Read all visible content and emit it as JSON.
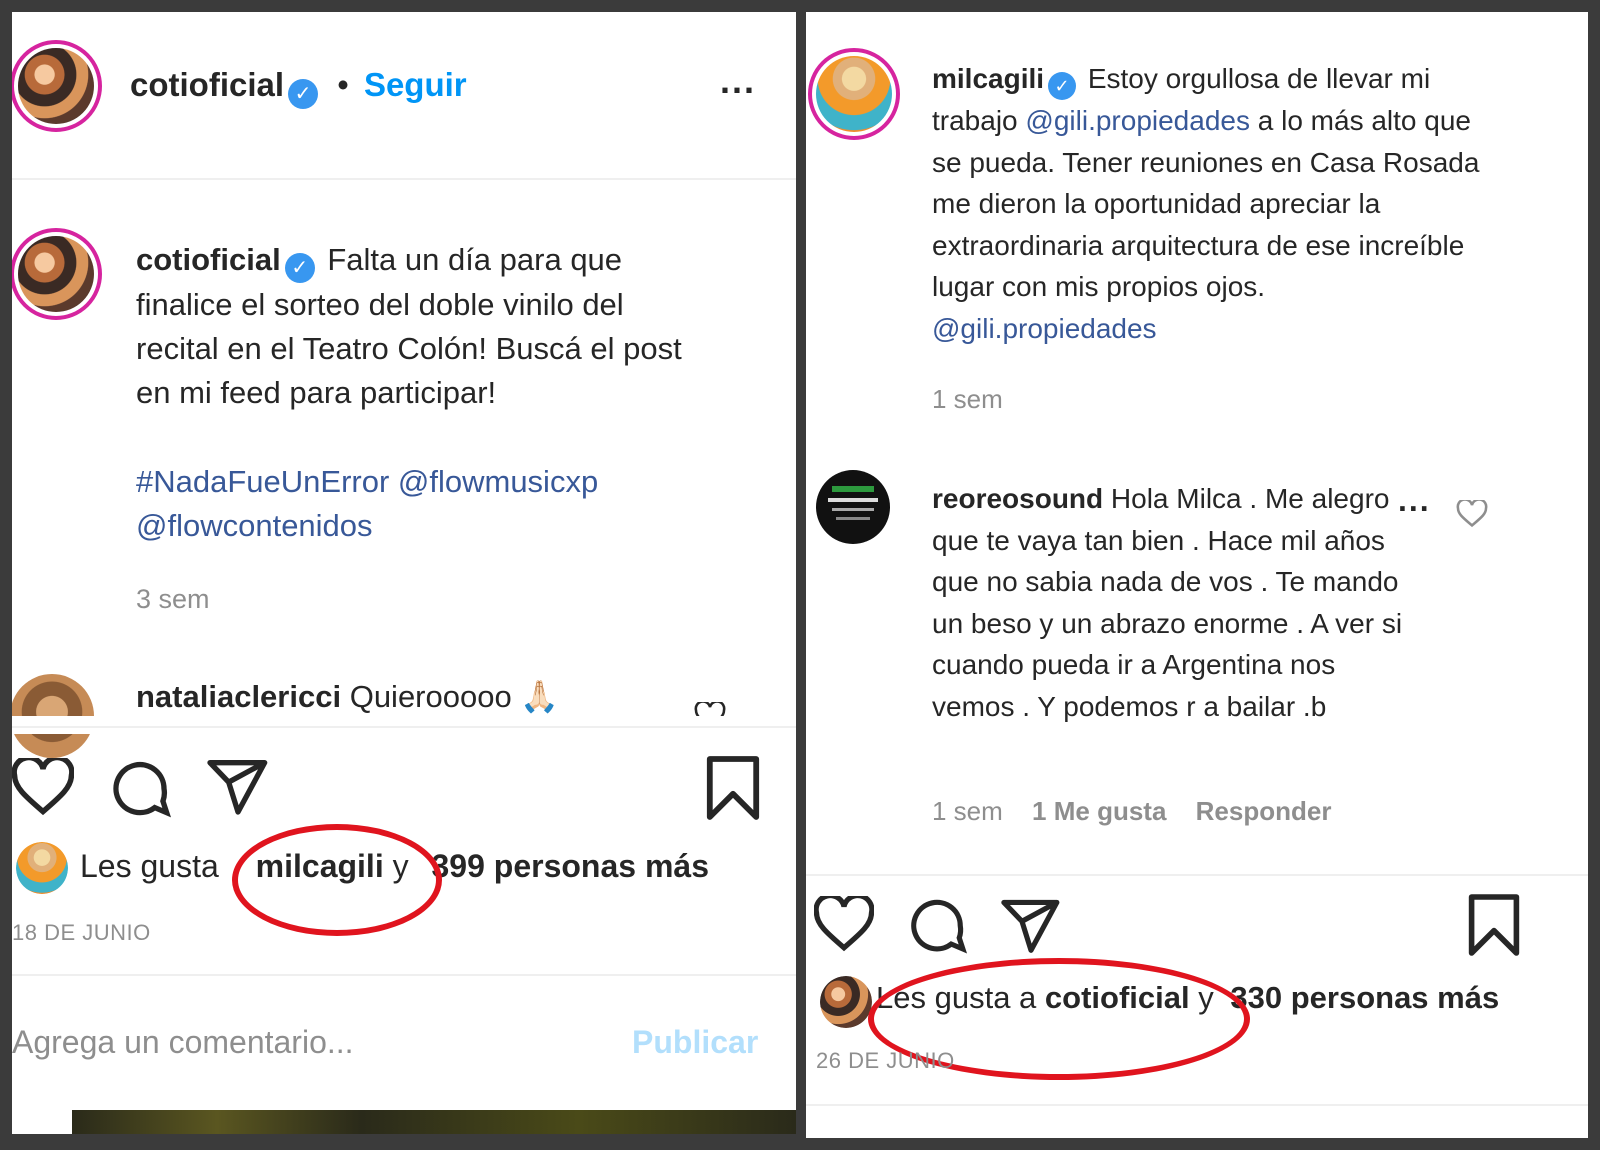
{
  "left_post": {
    "header": {
      "username": "cotioficial",
      "separator": "•",
      "follow_label": "Seguir",
      "more_label": "..."
    },
    "caption": {
      "username": "cotioficial",
      "text": "Falta un día para que finalice el sorteo del doble vinilo del recital en el Teatro Colón! Buscá el post en mi feed para participar!",
      "tags_line1": "#NadaFueUnError @flowmusicxp",
      "tags_line2": "@flowcontenidos",
      "time": "3 sem"
    },
    "comment": {
      "username": "nataliaclericci",
      "text": "Quierooooo",
      "emoji": "🙏🏻"
    },
    "likes": {
      "prefix": "Les gusta",
      "liker": "milcagili",
      "conjunction": "y",
      "rest": "399 personas más"
    },
    "date": "18 DE JUNIO",
    "comment_box": {
      "placeholder": "Agrega un comentario...",
      "publish_label": "Publicar"
    }
  },
  "right_post": {
    "caption": {
      "username": "milcagili",
      "text_before": "Estoy orgullosa de llevar mi trabajo",
      "mention1": "@gili.propiedades",
      "text_after": "a lo más alto que se pueda. Tener reuniones en Casa Rosada me dieron la oportunidad apreciar la extraordinaria arquitectura de ese increíble lugar con mis propios ojos.",
      "mention2": "@gili.propiedades",
      "time": "1 sem"
    },
    "comment": {
      "username": "reoreosound",
      "text": "Hola Milca . Me alegro que te vaya tan bien . Hace mil años que no sabia nada de vos . Te mando un beso y un abrazo enorme . A ver si cuando pueda ir a Argentina nos vemos . Y podemos r a bailar .b",
      "more_label": "...",
      "time": "1 sem",
      "likes": "1 Me gusta",
      "reply_label": "Responder"
    },
    "likes": {
      "prefix": "Les gusta a",
      "liker": "cotioficial",
      "conjunction": "y",
      "rest": "330 personas más"
    },
    "date": "26 DE JUNIO"
  },
  "colors": {
    "annotation_red": "#e0141e",
    "link_blue": "#385898",
    "accent_blue": "#0095f6",
    "verified_blue": "#3897f0"
  }
}
